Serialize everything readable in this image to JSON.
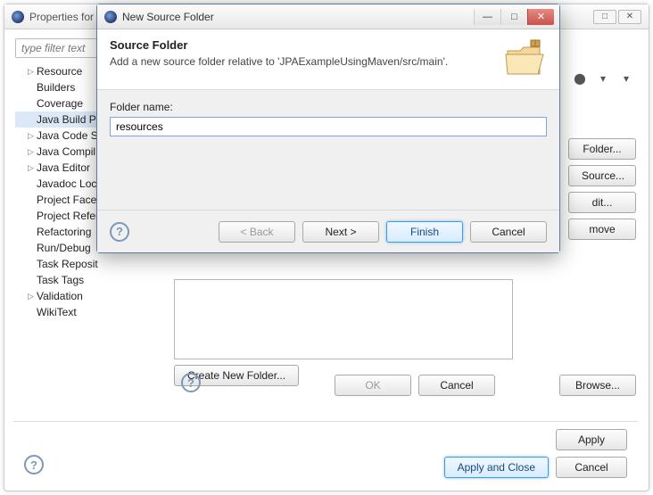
{
  "propertiesWindow": {
    "title": "Properties for",
    "filterPlaceholder": "type filter text",
    "tree": [
      {
        "label": "Resource",
        "expandable": true
      },
      {
        "label": "Builders",
        "expandable": false
      },
      {
        "label": "Coverage",
        "expandable": false
      },
      {
        "label": "Java Build Pa",
        "expandable": false,
        "selected": true
      },
      {
        "label": "Java Code St",
        "expandable": true
      },
      {
        "label": "Java Compil",
        "expandable": true
      },
      {
        "label": "Java Editor",
        "expandable": true
      },
      {
        "label": "Javadoc Loc",
        "expandable": false
      },
      {
        "label": "Project Face",
        "expandable": false
      },
      {
        "label": "Project Refer",
        "expandable": false
      },
      {
        "label": "Refactoring",
        "expandable": false
      },
      {
        "label": "Run/Debug",
        "expandable": false
      },
      {
        "label": "Task Reposit",
        "expandable": false
      },
      {
        "label": "Task Tags",
        "expandable": false
      },
      {
        "label": "Validation",
        "expandable": true
      },
      {
        "label": "WikiText",
        "expandable": false
      }
    ],
    "rightButtons": [
      "Folder...",
      "Source...",
      "dit...",
      "move"
    ],
    "createNewFolder": "Create New Folder...",
    "ok": "OK",
    "cancel": "Cancel",
    "browse": "Browse...",
    "apply": "Apply",
    "applyAndClose": "Apply and Close",
    "cancelBottom": "Cancel"
  },
  "dialog": {
    "windowTitle": "New Source Folder",
    "heading": "Source Folder",
    "description": "Add a new source folder relative to 'JPAExampleUsingMaven/src/main'.",
    "folderNameLabel": "Folder name:",
    "folderNameValue": "resources",
    "back": "< Back",
    "next": "Next >",
    "finish": "Finish",
    "cancel": "Cancel"
  }
}
